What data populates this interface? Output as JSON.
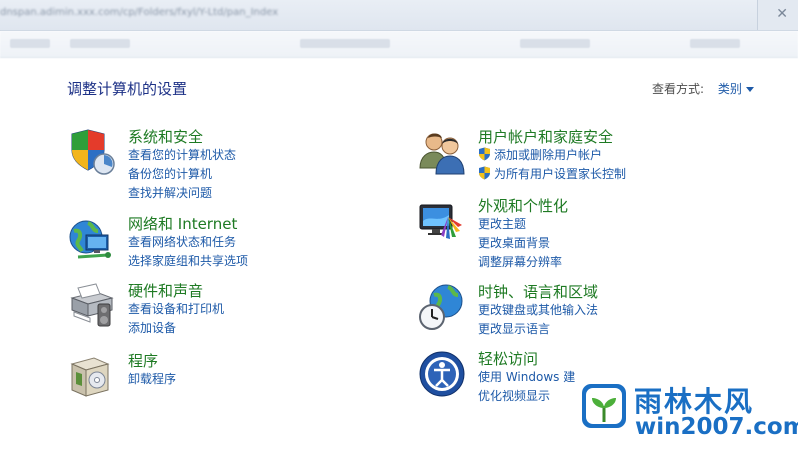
{
  "chrome": {
    "url_text": "dnspan.adimin.xxx.com/cp/Folders/fxyl/Y-Ltd/pan_Index",
    "close_glyph": "✕"
  },
  "page_title": "调整计算机的设置",
  "view_by": {
    "label": "查看方式:",
    "value": "类别"
  },
  "categories": [
    {
      "icon": "system-security-shield-icon",
      "heading": "系统和安全",
      "links": [
        "查看您的计算机状态",
        "备份您的计算机",
        "查找并解决问题"
      ]
    },
    {
      "icon": "network-globe-icon",
      "heading": "网络和 Internet",
      "links": [
        "查看网络状态和任务",
        "选择家庭组和共享选项"
      ]
    },
    {
      "icon": "hardware-printer-icon",
      "heading": "硬件和声音",
      "links": [
        "查看设备和打印机",
        "添加设备"
      ]
    },
    {
      "icon": "programs-box-icon",
      "heading": "程序",
      "links": [
        "卸载程序"
      ]
    },
    {
      "icon": "user-accounts-icon",
      "heading": "用户帐户和家庭安全",
      "links": [
        "添加或删除用户帐户",
        "为所有用户设置家长控制"
      ]
    },
    {
      "icon": "appearance-monitor-icon",
      "heading": "外观和个性化",
      "links": [
        "更改主题",
        "更改桌面背景",
        "调整屏幕分辨率"
      ]
    },
    {
      "icon": "clock-globe-icon",
      "heading": "时钟、语言和区域",
      "links": [
        "更改键盘或其他输入法",
        "更改显示语言"
      ]
    },
    {
      "icon": "ease-of-access-icon",
      "heading": "轻松访问",
      "links": [
        "使用 Windows 建",
        "优化视频显示"
      ]
    }
  ],
  "watermark": {
    "line1": "雨林木风",
    "line2": "win2007.com"
  },
  "colors": {
    "heading": "#1e7a23",
    "link": "#1e5aa8",
    "title": "#1e3287",
    "watermark": "#1a6fc4"
  }
}
